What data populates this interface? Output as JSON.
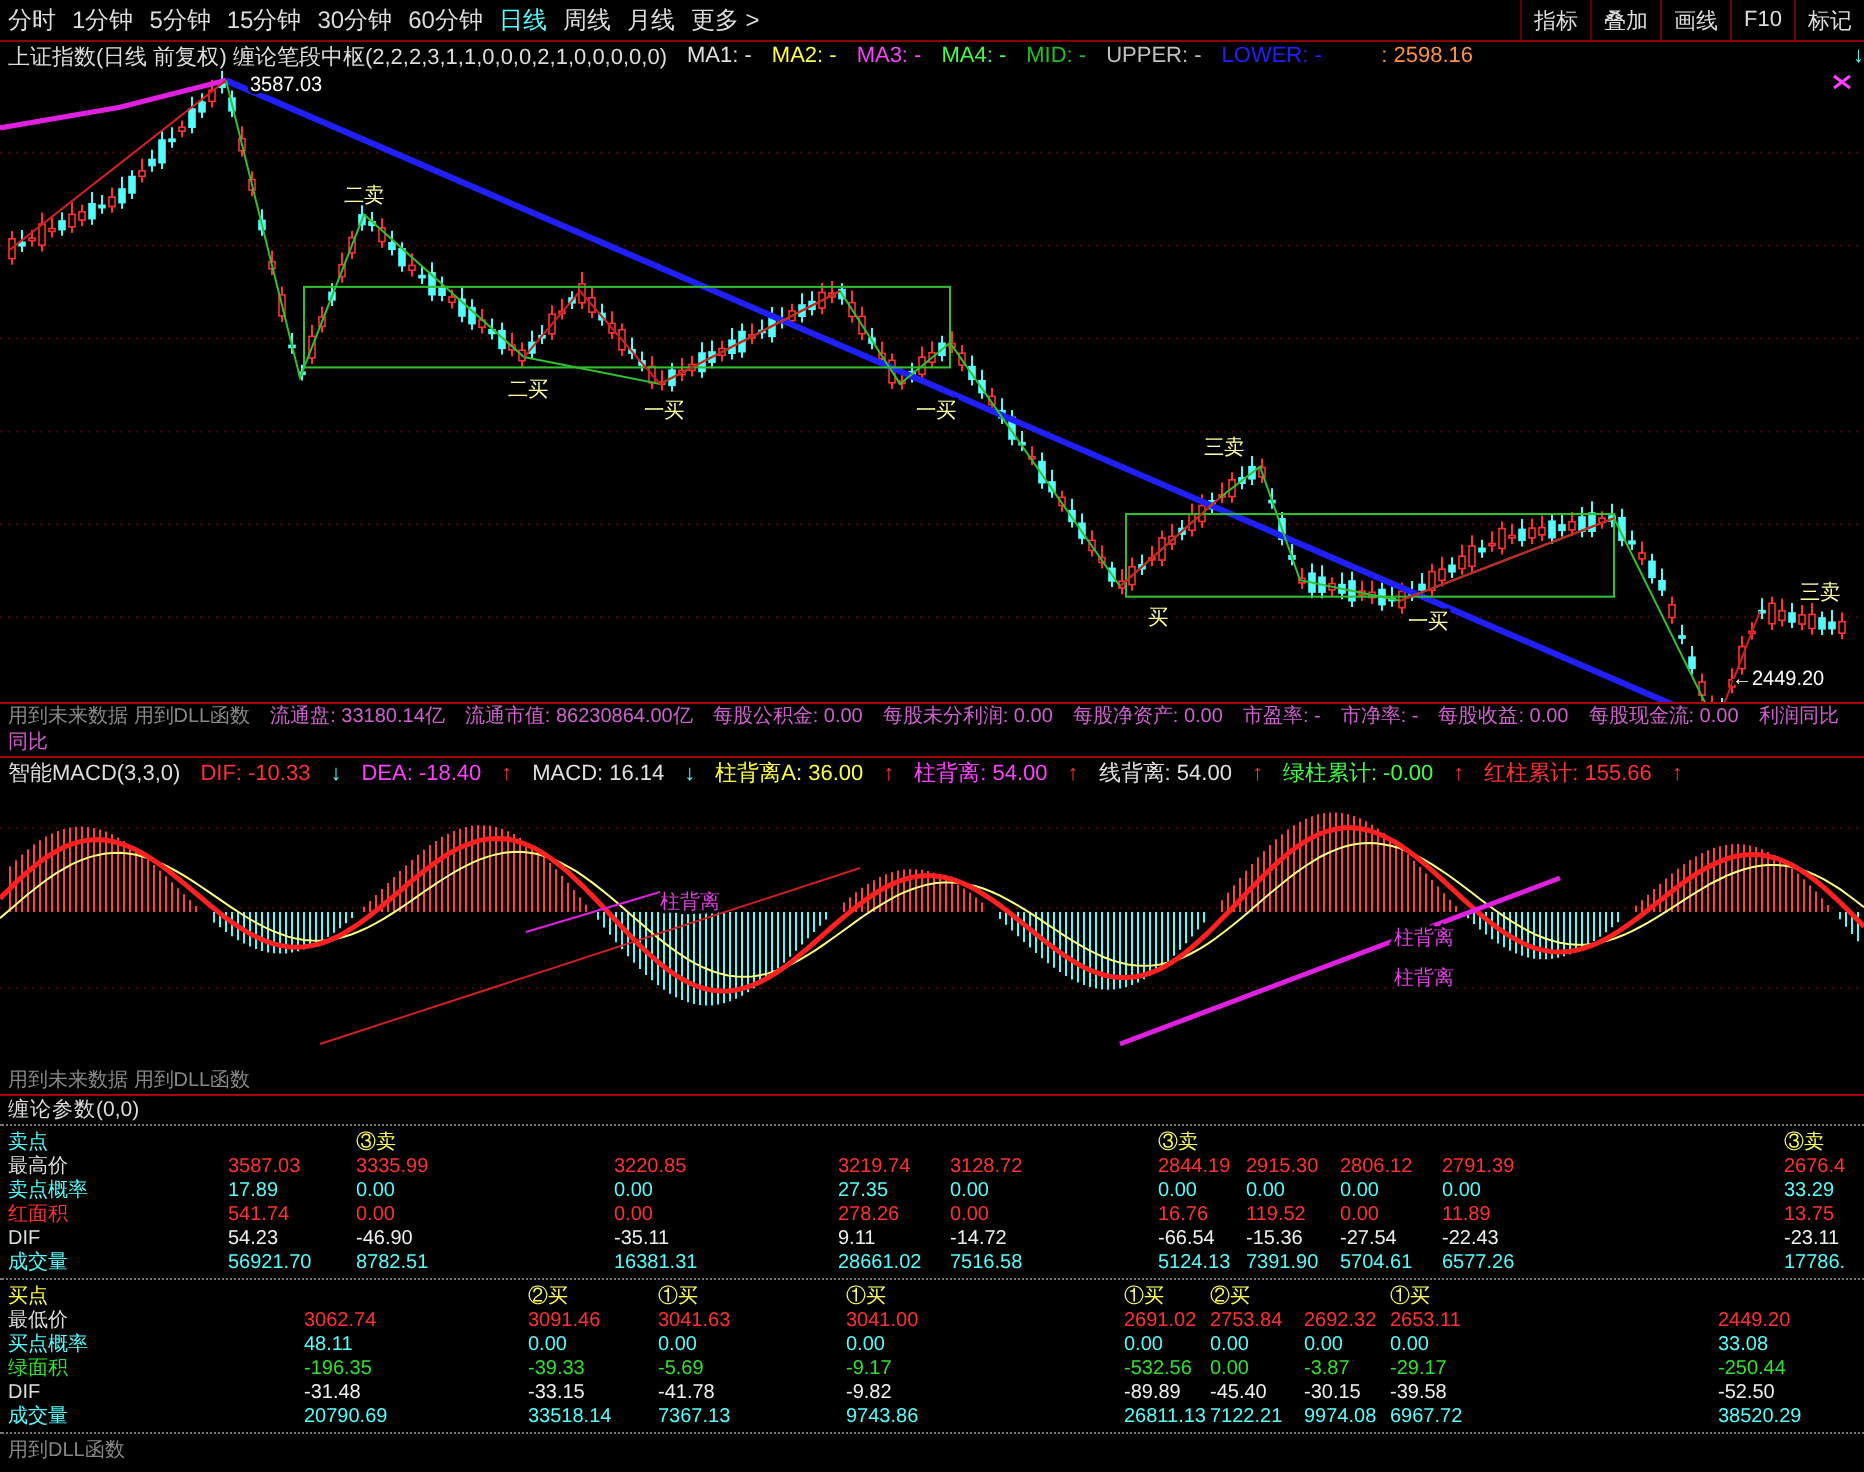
{
  "toolbar": {
    "periods": [
      {
        "label": "分时",
        "selected": false
      },
      {
        "label": "1分钟",
        "selected": false
      },
      {
        "label": "5分钟",
        "selected": false
      },
      {
        "label": "15分钟",
        "selected": false
      },
      {
        "label": "30分钟",
        "selected": false
      },
      {
        "label": "60分钟",
        "selected": false
      },
      {
        "label": "日线",
        "selected": true
      },
      {
        "label": "周线",
        "selected": false
      },
      {
        "label": "月线",
        "selected": false
      },
      {
        "label": "更多 >",
        "selected": false
      }
    ],
    "buttons": [
      "指标",
      "叠加",
      "画线",
      "F10",
      "标记"
    ]
  },
  "main_chart": {
    "title": "上证指数(日线 前复权) 缠论笔段中枢(2,2,2,3,1,1,0,0,0,2,1,0,0,0,0,0)",
    "legend": [
      {
        "label": "MA1: -",
        "color": "#e0e0e0"
      },
      {
        "label": "MA2: -",
        "color": "#ffff40"
      },
      {
        "label": "MA3: -",
        "color": "#ff40ff"
      },
      {
        "label": "MA4: -",
        "color": "#40ff40"
      },
      {
        "label": "MID: -",
        "color": "#20c020"
      },
      {
        "label": "UPPER: -",
        "color": "#c0c0c0"
      },
      {
        "label": "LOWER: -",
        "color": "#2020ff"
      }
    ],
    "price": ": 2598.16",
    "price_arrow": "↓",
    "labels": [
      "3587.03",
      "二卖",
      "二买",
      "一买",
      "一买",
      "三卖",
      "买",
      "一买",
      "三卖",
      "←2449.20"
    ]
  },
  "info_bar": {
    "note": "用到未来数据 用到DLL函数",
    "fields": [
      "流通盘: 33180.14亿",
      "流通市值: 86230864.00亿",
      "每股公积金: 0.00",
      "每股未分利润: 0.00",
      "每股净资产: 0.00",
      "市盈率: -",
      "市净率: -",
      "每股收益: 0.00",
      "每股现金流: 0.00",
      "利润同比",
      "同比"
    ]
  },
  "macd": {
    "title": "智能MACD(3,3,0)",
    "readings": [
      {
        "label": "DIF: -10.33",
        "arrow": "↓",
        "rising": false,
        "color": "#ff3030"
      },
      {
        "label": "DEA: -18.40",
        "arrow": "↑",
        "rising": true,
        "color": "#ff40ff"
      },
      {
        "label": "MACD: 16.14",
        "arrow": "↓",
        "rising": false,
        "color": "#e0e0e0"
      },
      {
        "label": "柱背离A: 36.00",
        "arrow": "↑",
        "rising": true,
        "color": "#ffff40"
      },
      {
        "label": "柱背离: 54.00",
        "arrow": "↑",
        "rising": true,
        "color": "#ff40ff"
      },
      {
        "label": "线背离: 54.00",
        "arrow": "↑",
        "rising": true,
        "color": "#e0e0e0"
      },
      {
        "label": "绿柱累计: -0.00",
        "arrow": "↑",
        "rising": true,
        "color": "#40ff40"
      },
      {
        "label": "红柱累计: 155.66",
        "arrow": "↑",
        "rising": true,
        "color": "#ff3030"
      }
    ],
    "labels": [
      "柱背离",
      "柱背离",
      "柱背离"
    ],
    "note": "用到未来数据 用到DLL函数"
  },
  "params": {
    "title": "缠论参数(0,0)",
    "sell": {
      "labels": [
        "卖点",
        "最高价",
        "卖点概率",
        "红面积",
        "DIF",
        "成交量"
      ],
      "columns": [
        {
          "values": [
            "3587.03",
            "17.89",
            "541.74",
            "54.23",
            "56921.70"
          ]
        },
        {
          "marker": "③卖",
          "values": [
            "3335.99",
            "0.00",
            "0.00",
            "-46.90",
            "8782.51"
          ]
        },
        {
          "values": [
            "3220.85",
            "0.00",
            "0.00",
            "-35.11",
            "16381.31"
          ]
        },
        {
          "values": [
            "3219.74",
            "27.35",
            "278.26",
            "9.11",
            "28661.02"
          ]
        },
        {
          "values": [
            "3128.72",
            "0.00",
            "0.00",
            "-14.72",
            "7516.58"
          ]
        },
        {
          "marker": "③卖",
          "values": [
            "2844.19",
            "0.00",
            "16.76",
            "-66.54",
            "5124.13"
          ]
        },
        {
          "values": [
            "2915.30",
            "0.00",
            "119.52",
            "-15.36",
            "7391.90"
          ]
        },
        {
          "values": [
            "2806.12",
            "0.00",
            "0.00",
            "-27.54",
            "5704.61"
          ]
        },
        {
          "values": [
            "2791.39",
            "0.00",
            "11.89",
            "-22.43",
            "6577.26"
          ]
        },
        {
          "marker": "③卖",
          "values": [
            "2676.4",
            "33.29",
            "13.75",
            "-23.11",
            "17786."
          ]
        }
      ]
    },
    "buy": {
      "labels": [
        "买点",
        "最低价",
        "买点概率",
        "绿面积",
        "DIF",
        "成交量"
      ],
      "columns": [
        {
          "values": [
            "3062.74",
            "48.11",
            "-196.35",
            "-31.48",
            "20790.69"
          ]
        },
        {
          "marker": "②买",
          "values": [
            "3091.46",
            "0.00",
            "-39.33",
            "-33.15",
            "33518.14"
          ]
        },
        {
          "marker": "①买",
          "values": [
            "3041.63",
            "0.00",
            "-5.69",
            "-41.78",
            "7367.13"
          ]
        },
        {
          "marker": "①买",
          "values": [
            "3041.00",
            "0.00",
            "-9.17",
            "-9.82",
            "9743.86"
          ]
        },
        {
          "marker": "①买",
          "values": [
            "2691.02",
            "0.00",
            "-532.56",
            "-89.89",
            "26811.13"
          ]
        },
        {
          "marker": "②买",
          "values": [
            "2753.84",
            "0.00",
            "0.00",
            "-45.40",
            "7122.21"
          ]
        },
        {
          "values": [
            "2692.32",
            "0.00",
            "-3.87",
            "-30.15",
            "9974.08"
          ]
        },
        {
          "marker": "①买",
          "values": [
            "2653.11",
            "0.00",
            "-29.17",
            "-39.58",
            "6967.72"
          ]
        },
        {
          "values": [
            "2449.20",
            "33.08",
            "-250.44",
            "-52.50",
            "38520.29"
          ]
        }
      ]
    },
    "note": "用到DLL函数"
  }
}
